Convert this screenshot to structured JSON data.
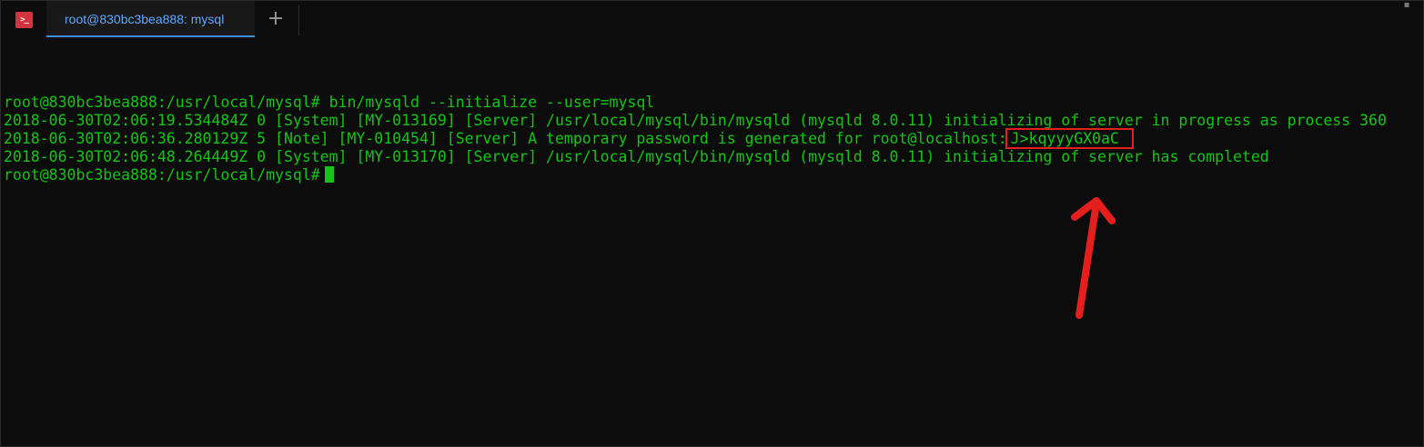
{
  "tab": {
    "title": "root@830bc3bea888: mysql",
    "new_tab": "+"
  },
  "window": {
    "app_icon": ">_",
    "app_icon_name": "terminal-icon"
  },
  "terminal": {
    "lines": [
      "root@830bc3bea888:/usr/local/mysql# bin/mysqld --initialize --user=mysql",
      "2018-06-30T02:06:19.534484Z 0 [System] [MY-013169] [Server] /usr/local/mysql/bin/mysqld (mysqld 8.0.11) initializing of server in progress as process 360",
      "2018-06-30T02:06:36.280129Z 5 [Note] [MY-010454] [Server] A temporary password is generated for root@localhost:",
      "2018-06-30T02:06:48.264449Z 0 [System] [MY-013170] [Server] /usr/local/mysql/bin/mysqld (mysqld 8.0.11) initializing of server has completed",
      "root@830bc3bea888:/usr/local/mysql#"
    ],
    "password": "J>kqyyyGX0aC"
  },
  "colors": {
    "background": "#0c0c0c",
    "text": "#13c613",
    "tab_accent": "#3a8fd8",
    "tab_text": "#5fa8ff",
    "annotation": "#e51e1e"
  }
}
